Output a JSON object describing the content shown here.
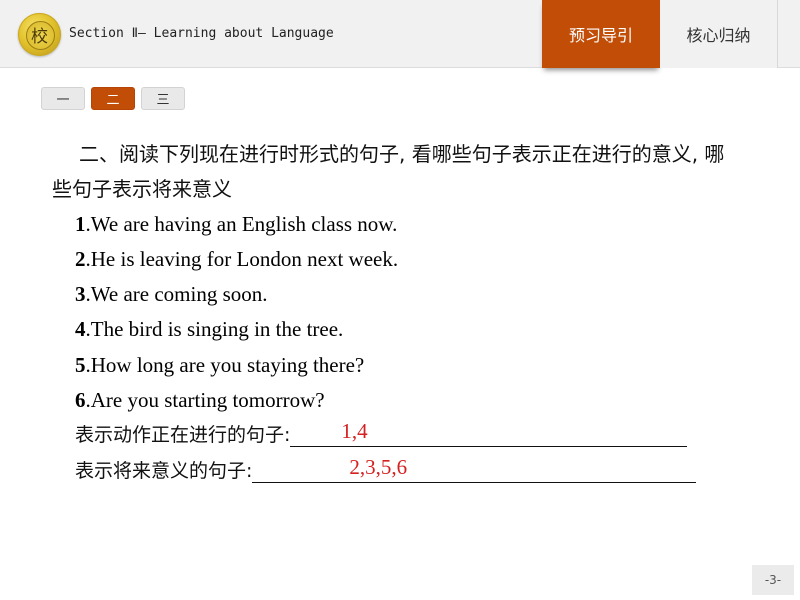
{
  "header": {
    "logo": "school-emblem-icon",
    "logo_glyph": "校",
    "section_title": "Section Ⅱ— Learning about Language",
    "tabs": [
      {
        "label": "预习导引",
        "active": true
      },
      {
        "label": "核心归纳",
        "active": false
      }
    ]
  },
  "pager": {
    "buttons": [
      {
        "label": "一",
        "active": false
      },
      {
        "label": "二",
        "active": true
      },
      {
        "label": "三",
        "active": false
      }
    ]
  },
  "content": {
    "question": "二、阅读下列现在进行时形式的句子, 看哪些句子表示正在进行的意义, 哪些句子表示将来意义",
    "sentences": [
      {
        "num": "1",
        "text": ".We are having  an English  class now."
      },
      {
        "num": "2",
        "text": ".He is leaving  for London next week."
      },
      {
        "num": "3",
        "text": ".We are coming  soon."
      },
      {
        "num": "4",
        "text": ".The bird is singing  in the tree."
      },
      {
        "num": "5",
        "text": ".How long  are you staying  there?"
      },
      {
        "num": "6",
        "text": ".Are you starting tomorrow?"
      }
    ],
    "answers": [
      {
        "label": "表示动作正在进行的句子:",
        "value": "1,4"
      },
      {
        "label": "表示将来意义的句子:",
        "value": "2,3,5,6"
      }
    ],
    "answer_color": "#d42020"
  },
  "footer": {
    "page_number": "-3-"
  },
  "colors": {
    "accent": "#c14d07",
    "header_bg": "#f1f1f1"
  }
}
